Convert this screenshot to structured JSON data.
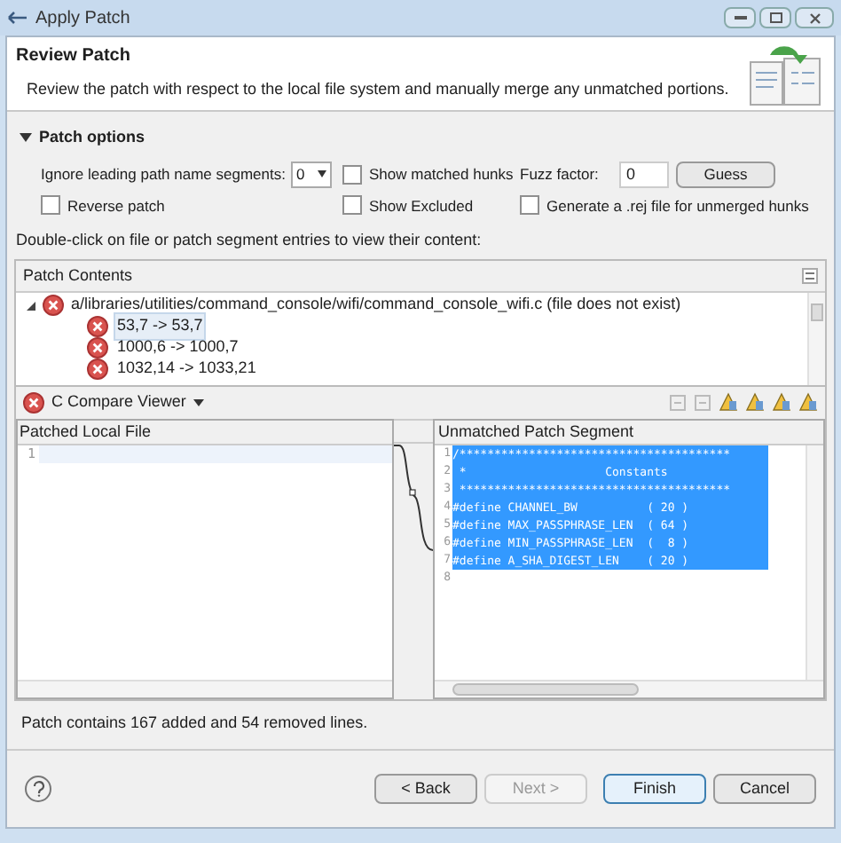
{
  "window": {
    "title": "Apply Patch"
  },
  "header": {
    "title": "Review Patch",
    "description": "Review the patch with respect to the local file system and manually merge any unmatched portions."
  },
  "patch_options": {
    "title": "Patch options",
    "expanded": true,
    "ignore_label": "Ignore leading path name segments:",
    "ignore_value": "0",
    "show_matched_hunks": {
      "label": "Show matched hunks",
      "checked": false
    },
    "reverse_patch": {
      "label": "Reverse patch",
      "checked": false
    },
    "show_excluded": {
      "label": "Show Excluded",
      "checked": false
    },
    "generate_rej": {
      "label": "Generate a .rej file for unmerged hunks",
      "checked": false
    },
    "fuzz_label": "Fuzz factor:",
    "fuzz_value": "0",
    "guess_button": "Guess"
  },
  "hint": "Double-click on file or patch segment entries to view their content:",
  "patch_contents": {
    "title": "Patch Contents",
    "items": [
      {
        "label": "a/libraries/utilities/command_console/wifi/command_console_wifi.c (file does not exist)",
        "expanded": true,
        "selected": false,
        "children": [
          {
            "label": "53,7 -> 53,7",
            "selected": true
          },
          {
            "label": "1000,6 -> 1000,7",
            "selected": false
          },
          {
            "label": "1032,14 -> 1033,21",
            "selected": false
          }
        ]
      }
    ]
  },
  "compare_viewer": {
    "title": "C Compare Viewer",
    "left": {
      "title": "Patched Local File",
      "lines": [
        {
          "number": "1"
        }
      ]
    },
    "right": {
      "title": "Unmatched Patch Segment",
      "lines": [
        {
          "number": "1",
          "text": "/***************************************",
          "selected": true
        },
        {
          "number": "2",
          "text": " *                    Constants",
          "selected": true
        },
        {
          "number": "3",
          "text": " ***************************************",
          "selected": true
        },
        {
          "number": "4",
          "text": "#define CHANNEL_BW          ( 20 )",
          "selected": true
        },
        {
          "number": "5",
          "text": "#define MAX_PASSPHRASE_LEN  ( 64 )",
          "selected": true
        },
        {
          "number": "6",
          "text": "#define MIN_PASSPHRASE_LEN  (  8 )",
          "selected": true
        },
        {
          "number": "7",
          "text": "#define A_SHA_DIGEST_LEN    ( 20 )",
          "selected": true
        },
        {
          "number": "8",
          "selected": false
        }
      ]
    }
  },
  "status": "Patch contains 167 added and 54 removed lines.",
  "buttons": [
    {
      "label": "< Back",
      "disabled": false,
      "default": false
    },
    {
      "label": "Next >",
      "disabled": true,
      "default": false
    },
    {
      "label": "Finish",
      "disabled": false,
      "default": true
    },
    {
      "label": "Cancel",
      "disabled": false,
      "default": false
    }
  ]
}
